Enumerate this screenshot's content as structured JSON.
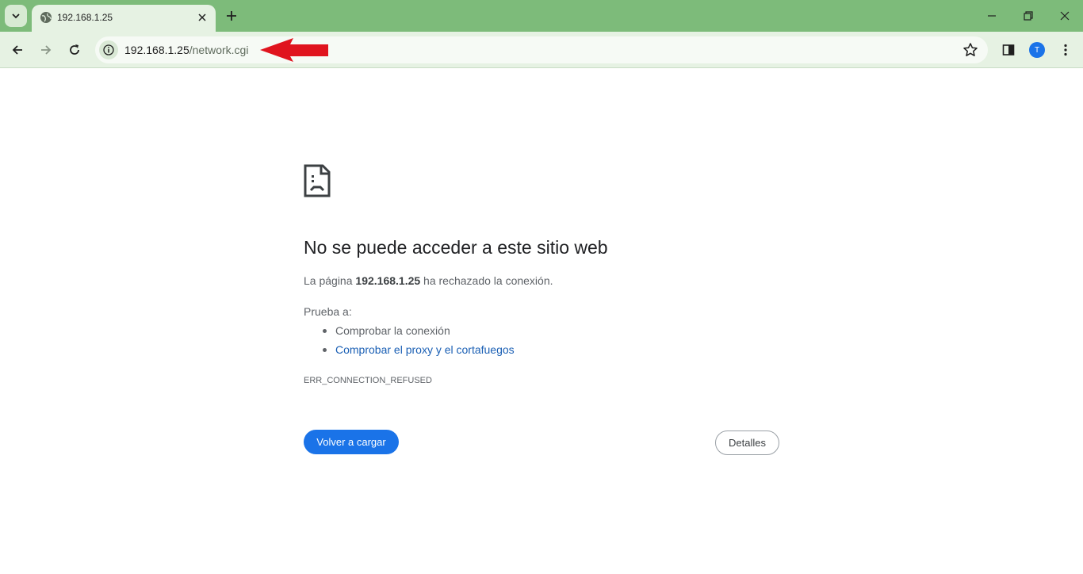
{
  "browser": {
    "tab_title": "192.168.1.25",
    "url_host": "192.168.1.25",
    "url_path": "/network.cgi",
    "avatar_initial": "T",
    "colors": {
      "frame": "#7dbb7a",
      "toolbar": "#e6f2e3",
      "annotation_arrow": "#e0141e"
    }
  },
  "error": {
    "title": "No se puede acceder a este sitio web",
    "desc_prefix": "La página",
    "desc_host": "192.168.1.25",
    "desc_suffix": "ha rechazado la conexión.",
    "try_label": "Prueba a:",
    "suggestions": [
      "Comprobar la conexión",
      "Comprobar el proxy y el cortafuegos"
    ],
    "code": "ERR_CONNECTION_REFUSED",
    "reload_label": "Volver a cargar",
    "details_label": "Detalles"
  }
}
